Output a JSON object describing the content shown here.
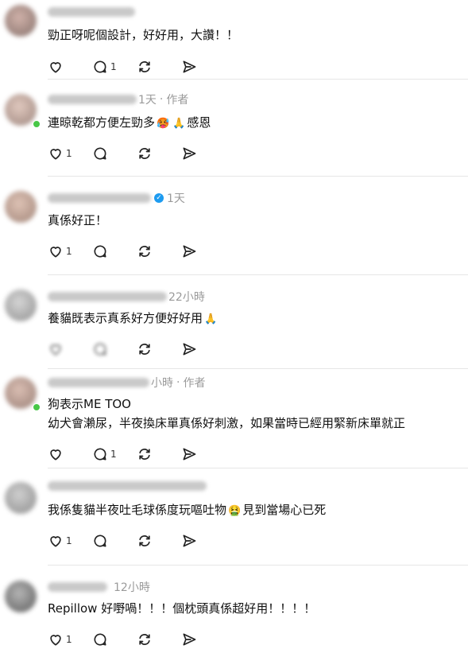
{
  "colors": {
    "text": "#111111",
    "meta": "#9a9a9a",
    "divider": "#e6e6e6",
    "online": "#48c747",
    "verified": "#1d9bf0"
  },
  "icons": [
    "heart-icon",
    "comment-icon",
    "repost-icon",
    "share-icon",
    "verified-icon"
  ],
  "comments": [
    {
      "time": "",
      "author_tag": "",
      "lines": [
        "勁正呀呢個設計，好好用，大讚！！"
      ],
      "likes": "",
      "replies": "1"
    },
    {
      "time": "1天",
      "author_tag": "作者",
      "lines": [
        "連晾乾都方便左勁多",
        "感恩"
      ],
      "likes": "1",
      "replies": ""
    },
    {
      "time": "1天",
      "author_tag": "",
      "lines": [
        "真係好正！"
      ],
      "likes": "1",
      "replies": ""
    },
    {
      "time": "22小時",
      "author_tag": "",
      "lines": [
        "養貓既表示真系好方便好好用"
      ],
      "likes": "",
      "replies": ""
    },
    {
      "time": "小時",
      "author_tag": "作者",
      "lines": [
        "狗表示ME TOO",
        "幼犬會瀨尿，半夜換床單真係好刺激，如果當時已經用緊新床單就正"
      ],
      "likes": "",
      "replies": "1"
    },
    {
      "time": "",
      "author_tag": "",
      "lines": [
        "我係隻貓半夜吐毛球係度玩嘔吐物",
        "見到當場心已死"
      ],
      "likes": "1",
      "replies": ""
    },
    {
      "time": "12小時",
      "author_tag": "",
      "lines": [
        "Repillow 好嘢喎！！！個枕頭真係超好用！！！！"
      ],
      "likes": "1",
      "replies": ""
    }
  ]
}
